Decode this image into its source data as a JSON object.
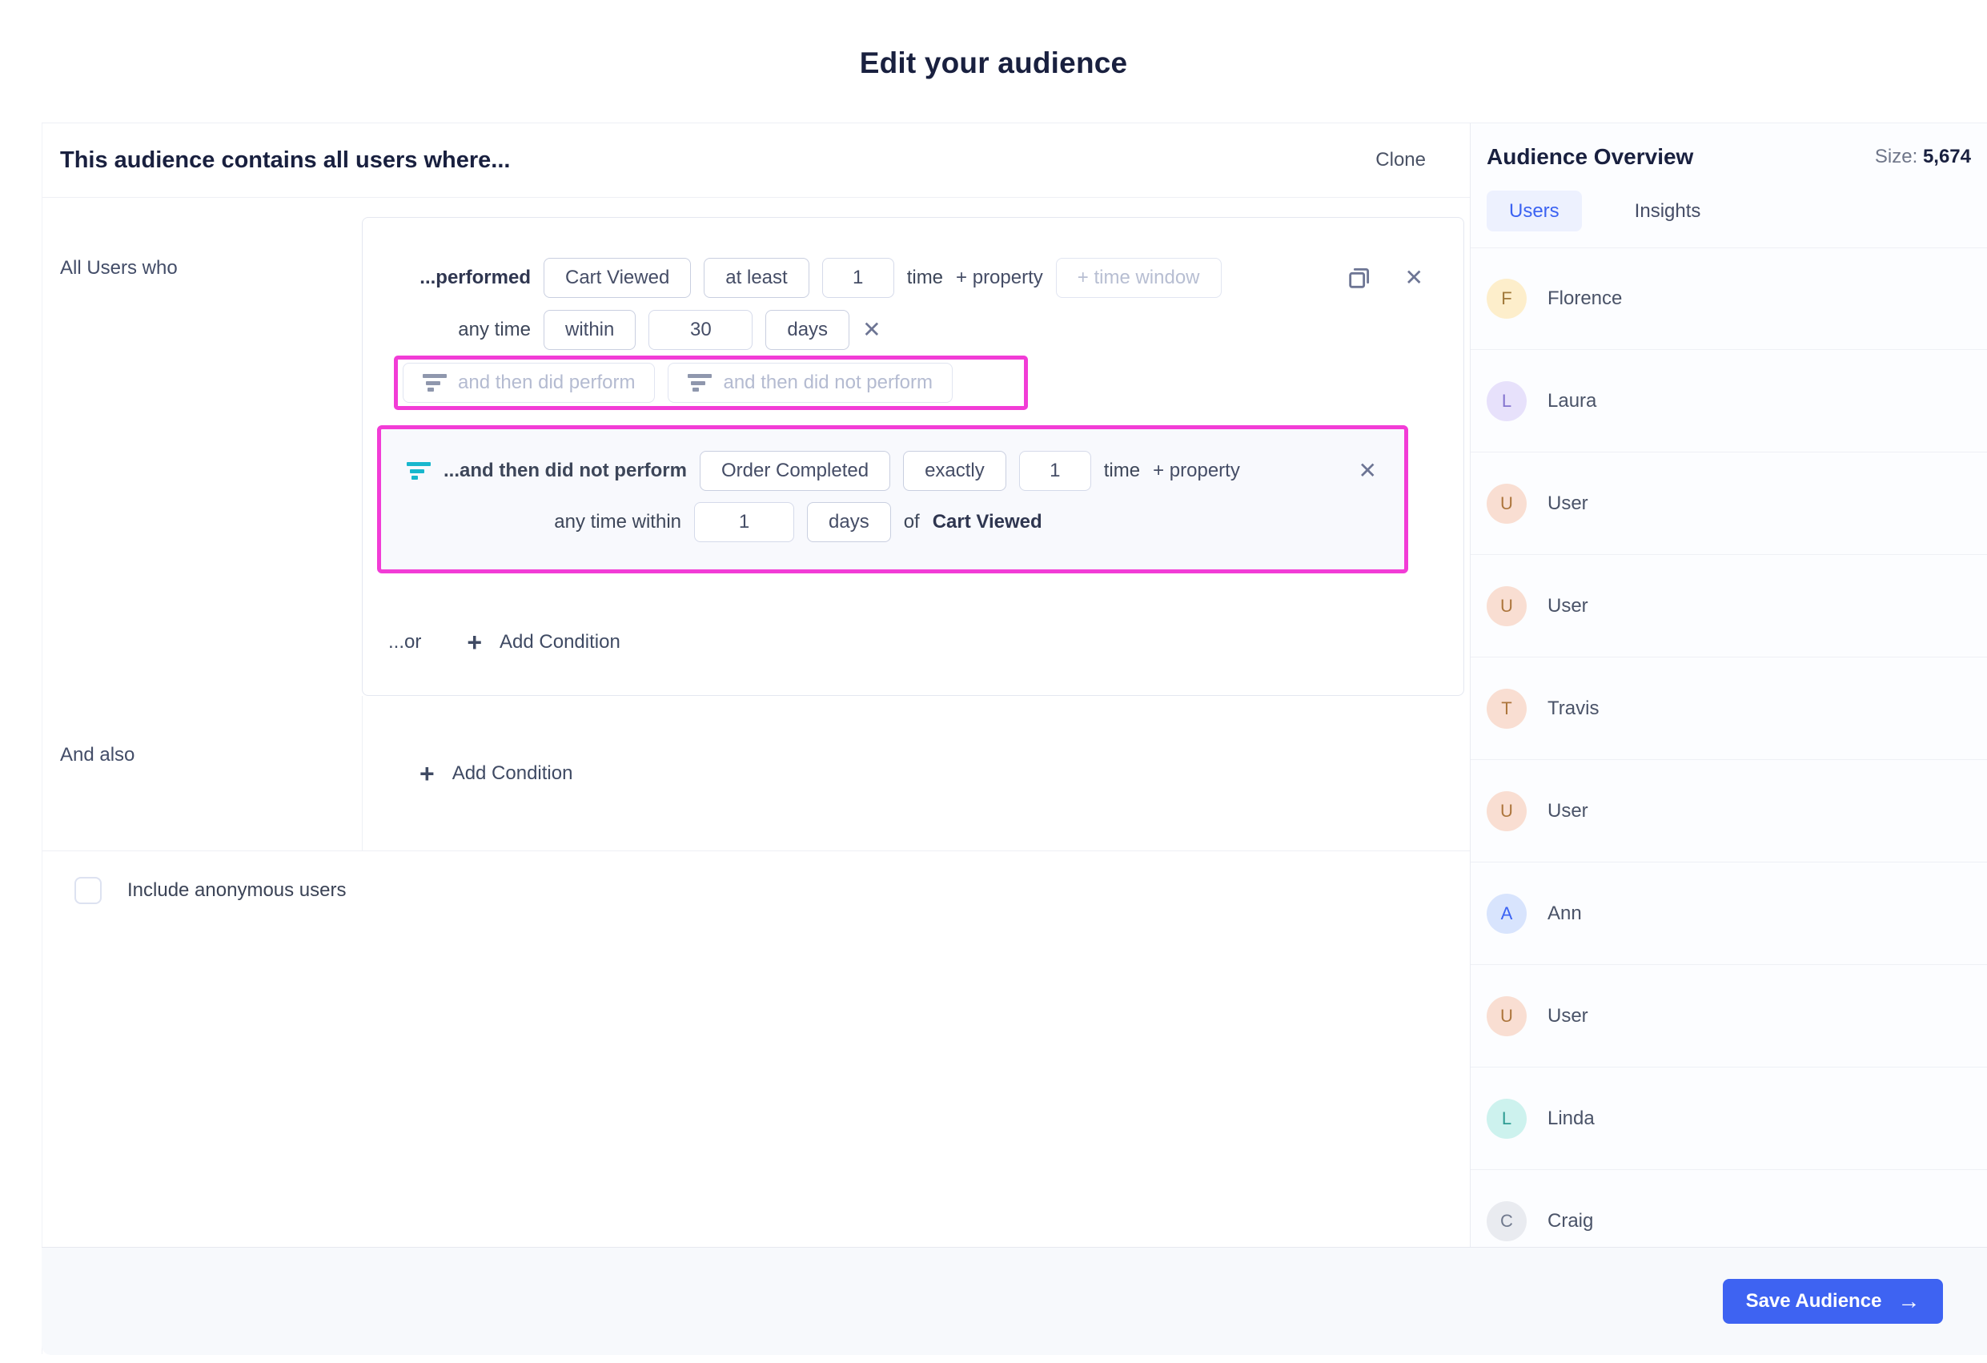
{
  "page": {
    "title": "Edit your audience"
  },
  "editor": {
    "header": {
      "title": "This audience contains all users where...",
      "clone_label": "Clone"
    },
    "left_labels": {
      "all_users": "All Users who",
      "and_also": "And also"
    },
    "condition_group": {
      "performed_row": {
        "prefix": "...performed",
        "event": "Cart Viewed",
        "operator": "at least",
        "count": "1",
        "count_suffix": "time",
        "add_property": "+ property",
        "time_window_placeholder": "+ time window"
      },
      "any_time_row": {
        "prefix": "any time",
        "operator": "within",
        "value": "30",
        "unit": "days"
      },
      "sequence_buttons": {
        "did_perform": "and then did perform",
        "did_not_perform": "and then did not perform"
      },
      "not_performed_row": {
        "prefix": "...and then did not perform",
        "event": "Order Completed",
        "operator": "exactly",
        "count": "1",
        "count_suffix": "time",
        "add_property": "+ property"
      },
      "within_row": {
        "prefix": "any time within",
        "value": "1",
        "unit": "days",
        "of_label": "of",
        "of_event": "Cart Viewed"
      },
      "or_row": {
        "prefix": "...or",
        "add_condition": "Add Condition"
      }
    },
    "and_also_add_condition": "Add Condition",
    "anonymous_checkbox_label": "Include anonymous users"
  },
  "overview": {
    "title": "Audience Overview",
    "size_label": "Size:",
    "size_value": "5,674",
    "tabs": [
      {
        "label": "Users",
        "active": true
      },
      {
        "label": "Insights",
        "active": false
      }
    ],
    "users": [
      {
        "name": "Florence",
        "initial": "F",
        "bg": "#fdeecb",
        "fg": "#a1793a"
      },
      {
        "name": "Laura",
        "initial": "L",
        "bg": "#e7e1fb",
        "fg": "#8474cf"
      },
      {
        "name": "User",
        "initial": "U",
        "bg": "#f9ded2",
        "fg": "#ad763d"
      },
      {
        "name": "User",
        "initial": "U",
        "bg": "#f9ded2",
        "fg": "#ad763d"
      },
      {
        "name": "Travis",
        "initial": "T",
        "bg": "#f9ded2",
        "fg": "#ad763d"
      },
      {
        "name": "User",
        "initial": "U",
        "bg": "#f9ded2",
        "fg": "#ad763d"
      },
      {
        "name": "Ann",
        "initial": "A",
        "bg": "#d8e4fd",
        "fg": "#3b63f3"
      },
      {
        "name": "User",
        "initial": "U",
        "bg": "#f9ded2",
        "fg": "#ad763d"
      },
      {
        "name": "Linda",
        "initial": "L",
        "bg": "#cdf2ee",
        "fg": "#2e9c93"
      },
      {
        "name": "Craig",
        "initial": "C",
        "bg": "#e9ebf0",
        "fg": "#717a8e"
      }
    ]
  },
  "footer": {
    "save_label": "Save Audience"
  },
  "colors": {
    "accent_blue": "#3e63f2",
    "highlight_magenta": "#f23cd6",
    "filter_teal": "#18b7cd",
    "heading_navy": "#19203f"
  }
}
